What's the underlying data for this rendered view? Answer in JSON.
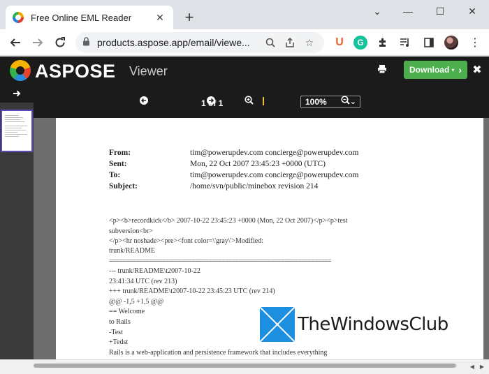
{
  "browser": {
    "tab_title": "Free Online EML Reader",
    "url": "products.aspose.app/email/viewe..."
  },
  "aspose": {
    "logo_text": "ASPOSE",
    "app_title": "Viewer",
    "download_label": "Download"
  },
  "viewer": {
    "page_indicator": "1 of 1",
    "zoom": "100%"
  },
  "email": {
    "headers": [
      {
        "label": "From:",
        "value": "tim@powerupdev.com concierge@powerupdev.com"
      },
      {
        "label": "Sent:",
        "value": "Mon, 22 Oct 2007 23:45:23 +0000 (UTC)"
      },
      {
        "label": "To:",
        "value": "tim@powerupdev.com concierge@powerupdev.com"
      },
      {
        "label": "Subject:",
        "value": "/home/svn/public/minebox revision 214"
      }
    ],
    "body_lines": [
      "<p><b>recordkick</b> 2007-10-22 23:45:23 +0000 (Mon, 22 Oct 2007)</p><p>test",
      "subversion<br>",
      "</p><hr noshade><pre><font color=\\'gray\\'>Modified:",
      "trunk/README",
      "===================================================================",
      "--- trunk/README\\t2007-10-22",
      "23:41:34 UTC (rev 213)",
      "+++ trunk/README\\t2007-10-22 23:45:23 UTC (rev 214)",
      "@@ -1,5 +1,5 @@",
      " == Welcome",
      "to Rails",
      "-Test",
      "+Tedst",
      " Rails is a web-application and persistence framework that includes everything"
    ]
  },
  "watermark": {
    "text": "TheWindowsClub"
  },
  "colors": {
    "aspose_header_bg": "#1b1b1b",
    "download_green": "#4cae4c",
    "thumb_border": "#5a4bb6",
    "watermark_blue": "#1d8fe1"
  }
}
